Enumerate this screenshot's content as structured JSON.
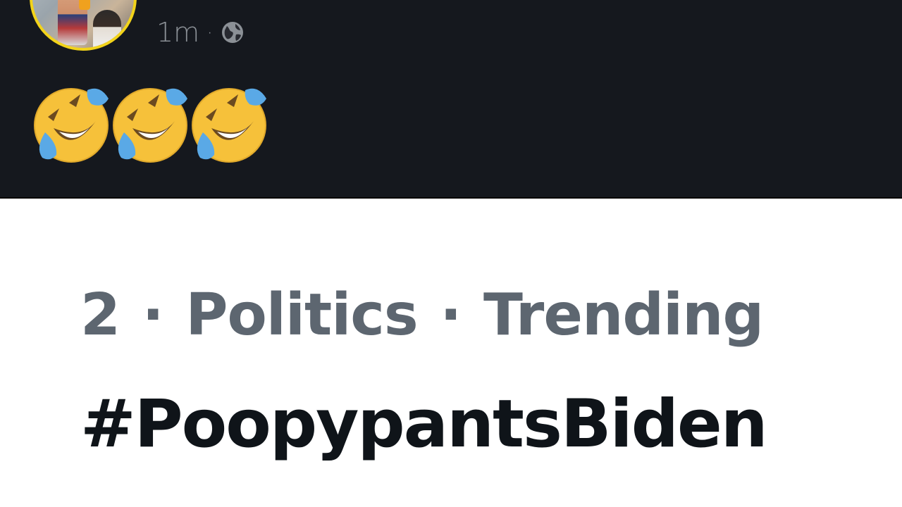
{
  "post": {
    "time": "1m",
    "dot": "·",
    "visibility_icon": "globe-icon",
    "emojis": [
      "rofl-emoji",
      "rofl-emoji",
      "rofl-emoji"
    ],
    "avatar_border_color": "#f2d31a",
    "background_color": "#15181e"
  },
  "trend": {
    "rank": "2",
    "separator": "·",
    "category": "Politics",
    "label": "Trending",
    "hashtag": "#PoopypantsBiden",
    "tweet_count": "",
    "meta_color": "#5d6670",
    "hashtag_color": "#0f1419"
  }
}
